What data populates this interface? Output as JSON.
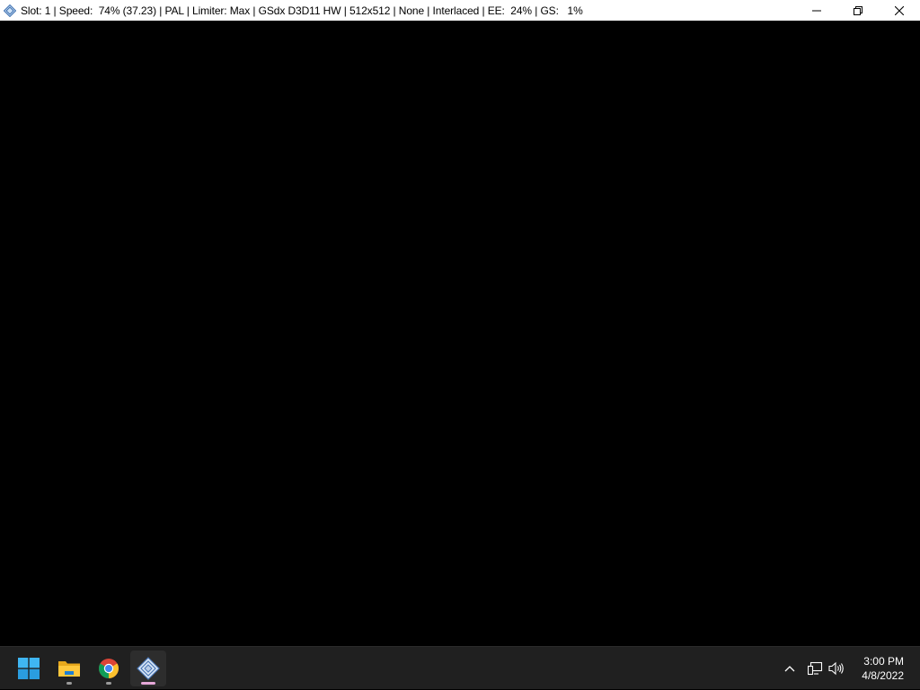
{
  "window": {
    "title": "Slot: 1 | Speed:  74% (37.23) | PAL | Limiter: Max | GSdx D3D11 HW | 512x512 | None | Interlaced | EE:  24% | GS:   1%",
    "app_icon": "pcsx2-diamond-icon",
    "controls": [
      "minimize-icon",
      "restore-icon",
      "close-icon"
    ]
  },
  "taskbar": {
    "apps": [
      {
        "name": "Start",
        "icon": "windows-start-icon",
        "running": false
      },
      {
        "name": "File Explorer",
        "icon": "folder-icon",
        "running": true
      },
      {
        "name": "Google Chrome",
        "icon": "chrome-icon",
        "running": true
      },
      {
        "name": "PCSX2",
        "icon": "pcsx2-diamond-icon",
        "running": true,
        "active": true
      }
    ],
    "tray_icons": [
      "chevron-up-icon",
      "network-icon",
      "volume-icon"
    ],
    "clock": {
      "time": "3:00 PM",
      "date": "4/8/2022"
    }
  },
  "colors": {
    "titlebar_bg": "#ffffff",
    "viewport_bg": "#000000",
    "taskbar_bg": "#202020",
    "active_indicator": "#e7a8d9"
  }
}
